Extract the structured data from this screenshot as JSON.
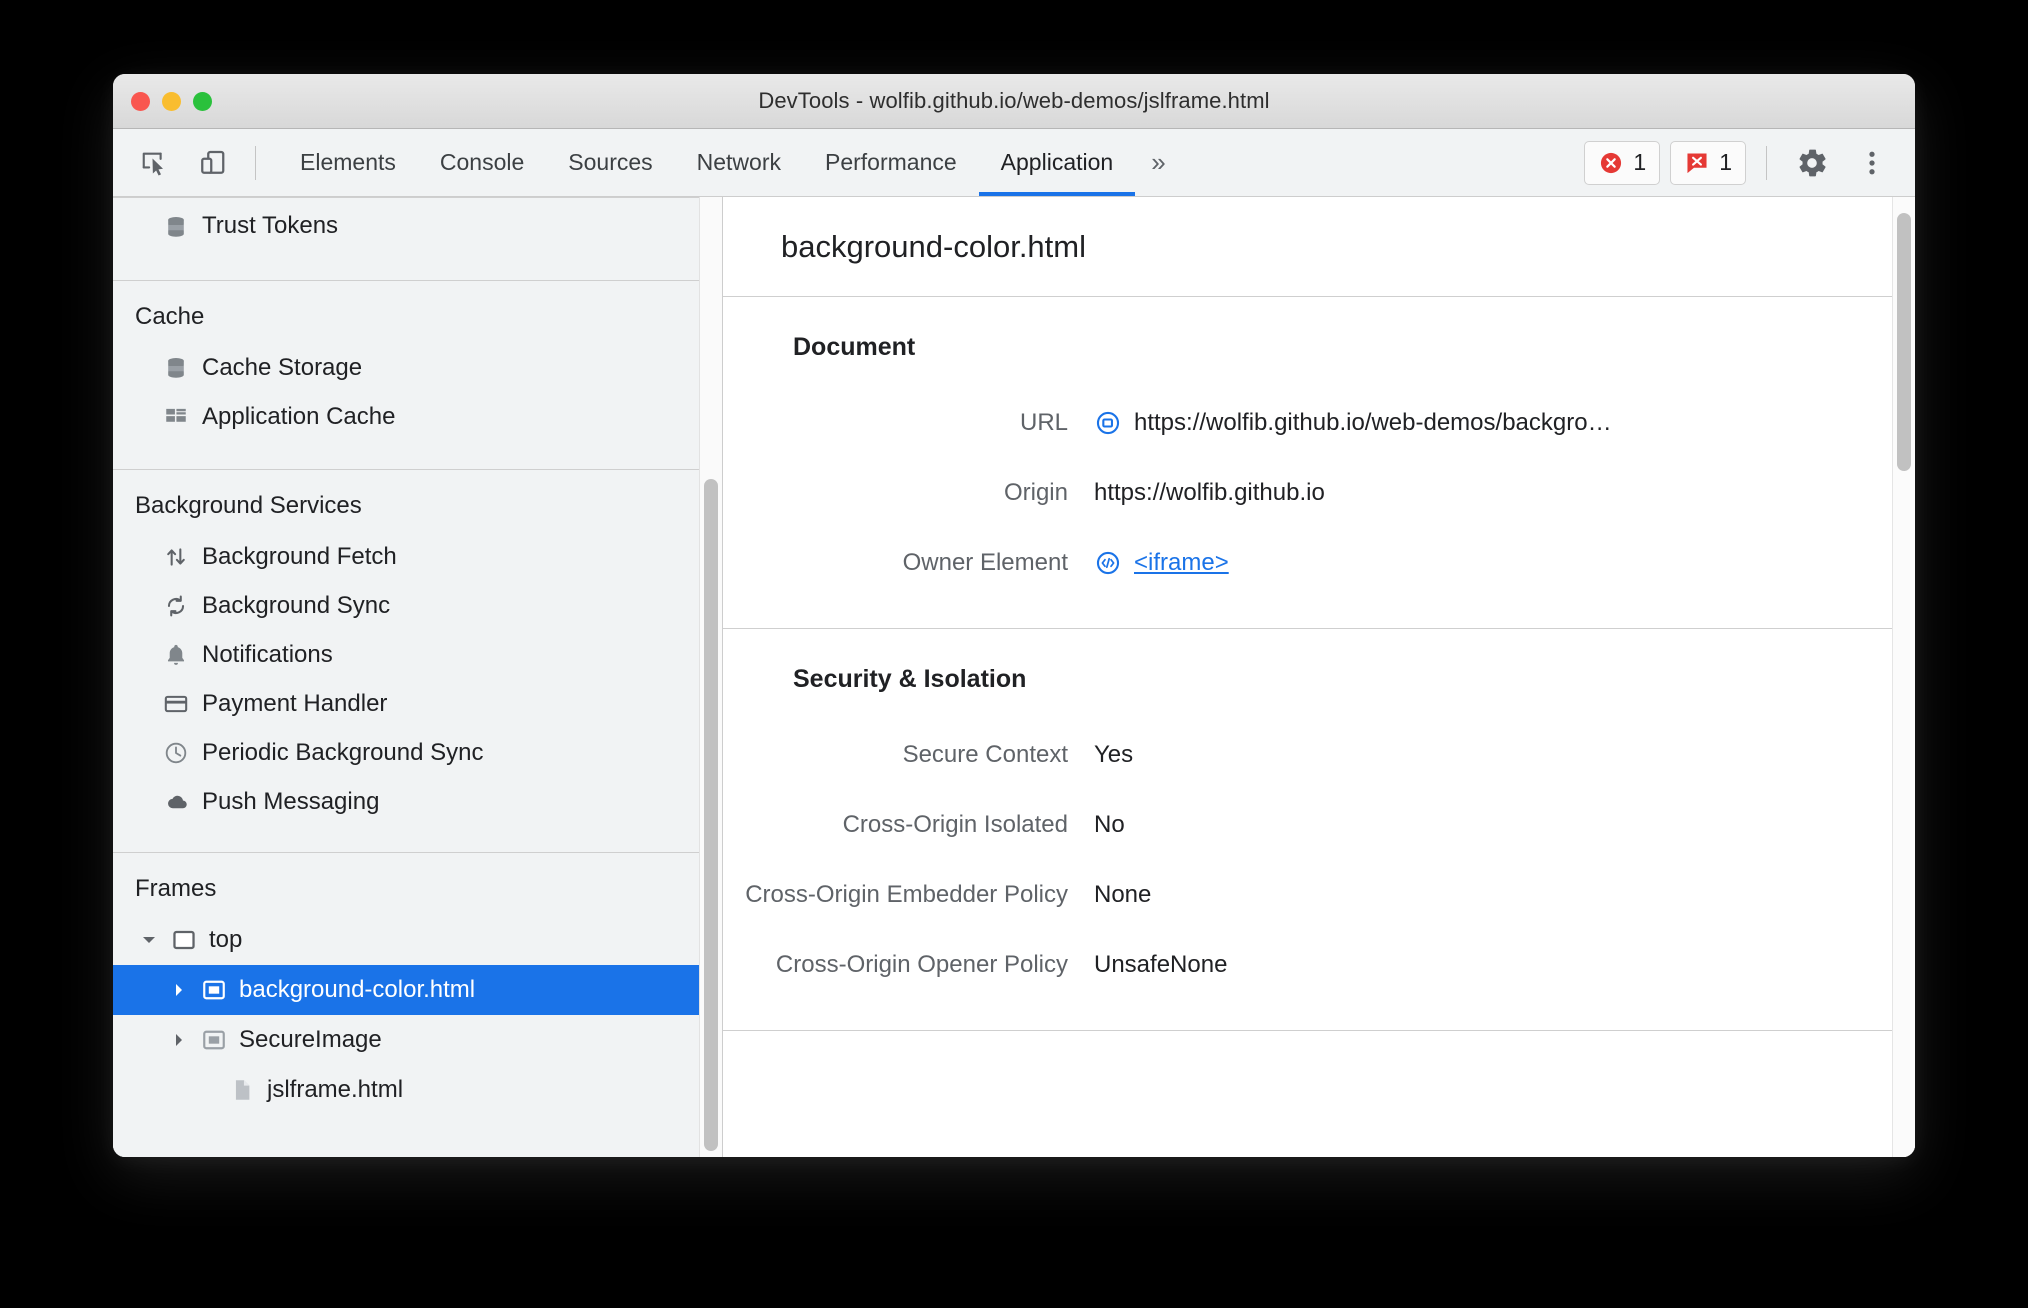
{
  "window": {
    "title": "DevTools - wolfib.github.io/web-demos/jslframe.html",
    "traffic_lights": [
      "close",
      "minimize",
      "maximize"
    ]
  },
  "toolbar": {
    "inspect_tooltip": "Inspect",
    "device_tooltip": "Toggle device toolbar",
    "tabs": [
      {
        "label": "Elements",
        "active": false
      },
      {
        "label": "Console",
        "active": false
      },
      {
        "label": "Sources",
        "active": false
      },
      {
        "label": "Network",
        "active": false
      },
      {
        "label": "Performance",
        "active": false
      },
      {
        "label": "Application",
        "active": true
      }
    ],
    "more_tabs_label": "»",
    "error_badge_count": "1",
    "issue_badge_count": "1",
    "settings_label": "Settings",
    "menu_label": "Customize and control DevTools",
    "accent_color": "#1a73e8",
    "error_color": "#e53935"
  },
  "sidebar": {
    "top_item": {
      "label": "Trust Tokens",
      "icon": "database-icon"
    },
    "groups": [
      {
        "title": "Cache",
        "items": [
          {
            "label": "Cache Storage",
            "icon": "database-icon"
          },
          {
            "label": "Application Cache",
            "icon": "grid-icon"
          }
        ]
      },
      {
        "title": "Background Services",
        "items": [
          {
            "label": "Background Fetch",
            "icon": "arrows-updown-icon"
          },
          {
            "label": "Background Sync",
            "icon": "sync-icon"
          },
          {
            "label": "Notifications",
            "icon": "bell-icon"
          },
          {
            "label": "Payment Handler",
            "icon": "credit-card-icon"
          },
          {
            "label": "Periodic Background Sync",
            "icon": "clock-icon"
          },
          {
            "label": "Push Messaging",
            "icon": "cloud-icon"
          }
        ]
      }
    ],
    "frames": {
      "title": "Frames",
      "nodes": [
        {
          "label": "top",
          "level": 1,
          "twisty": "expanded",
          "icon": "window-icon",
          "selected": false
        },
        {
          "label": "background-color.html",
          "level": 2,
          "twisty": "collapsed",
          "icon": "frame-icon",
          "selected": true
        },
        {
          "label": "SecureImage",
          "level": 2,
          "twisty": "collapsed",
          "icon": "frame-icon",
          "selected": false
        },
        {
          "label": "jslframe.html",
          "level": 3,
          "twisty": "none",
          "icon": "document-icon",
          "selected": false
        }
      ],
      "selection_color": "#1a73e8"
    }
  },
  "main": {
    "header_title": "background-color.html",
    "sections": [
      {
        "title": "Document",
        "rows": [
          {
            "label": "URL",
            "value": "https://wolfib.github.io/web-demos/backgro…",
            "icon": "reveal-in-elements-icon",
            "link": false
          },
          {
            "label": "Origin",
            "value": "https://wolfib.github.io",
            "icon": "",
            "link": false
          },
          {
            "label": "Owner Element",
            "value": "<iframe>",
            "icon": "code-icon",
            "link": true
          }
        ]
      },
      {
        "title": "Security & Isolation",
        "rows": [
          {
            "label": "Secure Context",
            "value": "Yes",
            "icon": "",
            "link": false
          },
          {
            "label": "Cross-Origin Isolated",
            "value": "No",
            "icon": "",
            "link": false
          },
          {
            "label": "Cross-Origin Embedder Policy",
            "value": "None",
            "icon": "",
            "link": false
          },
          {
            "label": "Cross-Origin Opener Policy",
            "value": "UnsafeNone",
            "icon": "",
            "link": false
          }
        ]
      }
    ]
  }
}
